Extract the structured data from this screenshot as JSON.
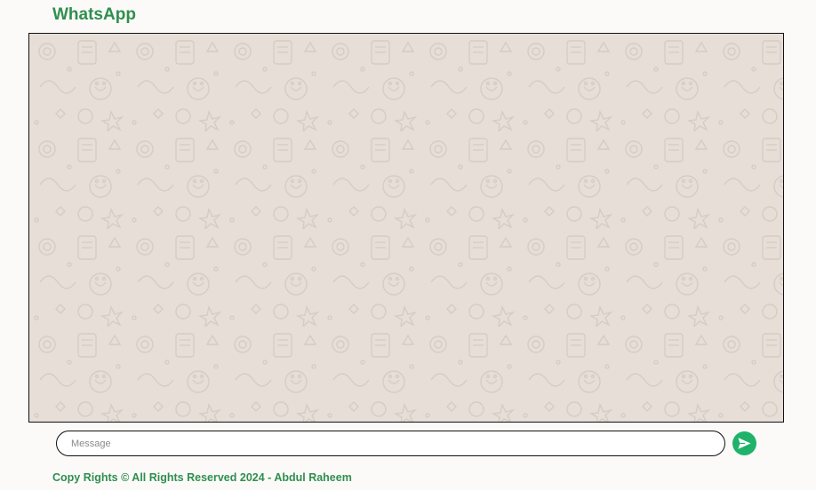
{
  "header": {
    "title": "WhatsApp"
  },
  "chat": {
    "background_icon": "doodle-pattern"
  },
  "composer": {
    "placeholder": "Message",
    "value": "",
    "send_icon": "send-arrow-icon"
  },
  "footer": {
    "text": "Copy Rights © All Rights Reserved 2024 - Abdul Raheem"
  },
  "colors": {
    "brand_green": "#2f8f4e",
    "send_button": "#1fb36a",
    "chat_background": "#e6ded7"
  }
}
